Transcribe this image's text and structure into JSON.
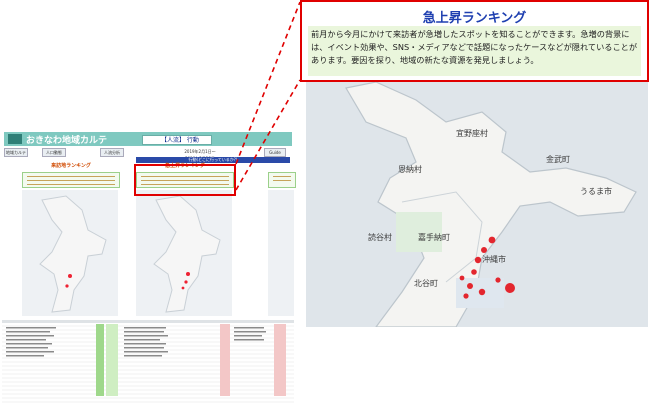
{
  "dashboard": {
    "app_title": "おきなわ地域カルテ",
    "header_box": "【人流】 行動",
    "tabs": [
      "地域カルテ",
      "人口動態",
      "人流分析",
      "経済分析",
      "Guide"
    ],
    "period_text": "2019年2月1日～2019年2月28日",
    "blue_bar": "行動(どこに行っているか?)",
    "panels": [
      {
        "title": "来訪地ランキング"
      },
      {
        "title": "急上昇ランキング"
      }
    ]
  },
  "zoom": {
    "title": "急上昇ランキング",
    "description": "前月から今月にかけて来訪者が急増したスポットを知ることができます。急増の背景には、イベント効果や、SNS・メディアなどで話題になったケースなどが隠れていることがあります。要因を探り、地域の新たな資源を発見しましょう。"
  },
  "map_labels": [
    "宜野座村",
    "金武町",
    "うるま市",
    "恩納村",
    "読谷村",
    "嘉手納町",
    "沖縄市",
    "北谷町"
  ],
  "colors": {
    "accent_red": "#e00000",
    "title_blue": "#1e3fb0",
    "header_teal": "#7fc9c0",
    "desc_bg": "#eaf6dc"
  }
}
